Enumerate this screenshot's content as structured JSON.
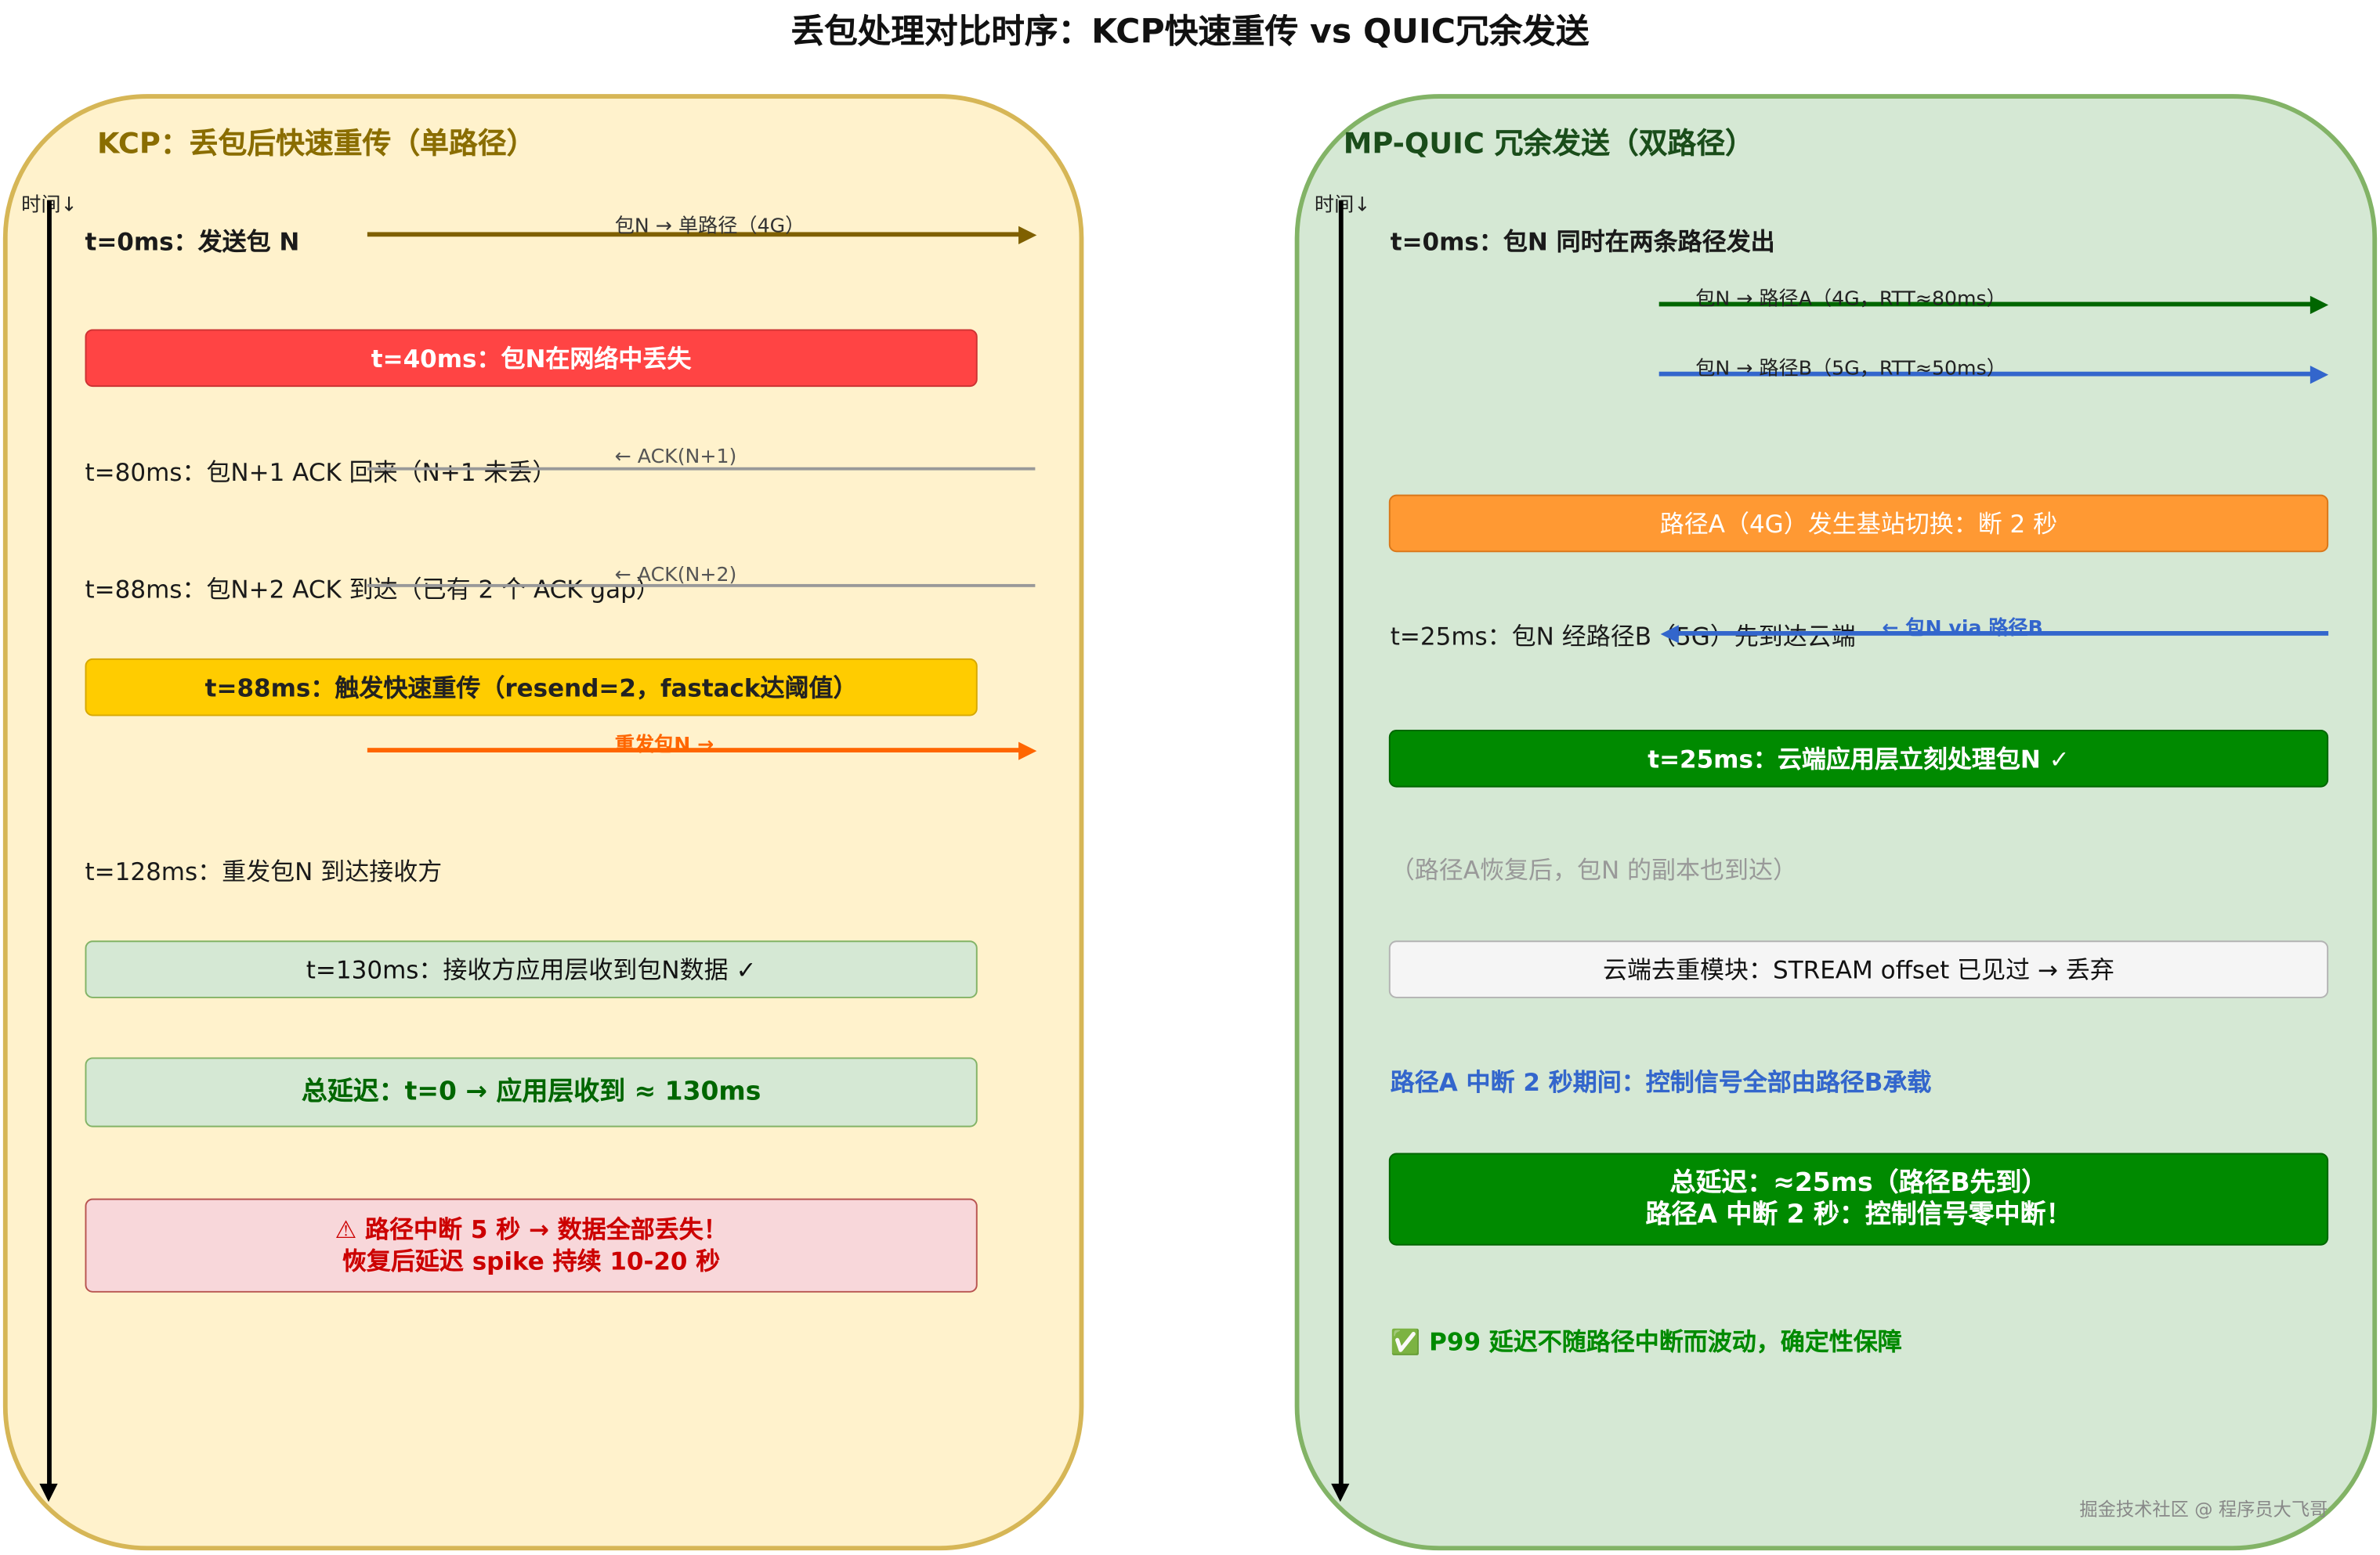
{
  "title": "丢包处理对比时序：KCP快速重传 vs QUIC冗余发送",
  "kcp": {
    "title": "KCP：丢包后快速重传（单路径）",
    "axis_label": "时间↓",
    "t0": "t=0ms：发送包 N",
    "t0_arrow": "包N → 单路径（4G）",
    "t40": "t=40ms：包N在网络中丢失",
    "t80": "t=80ms：包N+1 ACK 回来（N+1 未丢）",
    "ack1": "← ACK(N+1)",
    "t88": "t=88ms：包N+2 ACK 到达（已有 2 个 ACK gap）",
    "ack2": "← ACK(N+2)",
    "fast_resend": "t=88ms：触发快速重传（resend=2，fastack达阈值）",
    "resend_arrow": "重发包N →",
    "t128": "t=128ms：重发包N 到达接收方",
    "t130": "t=130ms：接收方应用层收到包N数据 ✓",
    "total": "总延迟：t=0 → 应用层收到 ≈ 130ms",
    "warning_line1": "⚠ 路径中断 5 秒 → 数据全部丢失！",
    "warning_line2": "恢复后延迟 spike 持续 10-20 秒"
  },
  "quic": {
    "title": "MP-QUIC 冗余发送（双路径）",
    "axis_label": "时间↓",
    "t0": "t=0ms：包N 同时在两条路径发出",
    "arrow_a": "包N → 路径A（4G，RTT≈80ms）",
    "arrow_b": "包N → 路径B（5G，RTT≈50ms）",
    "handover": "路径A（4G）发生基站切换：断 2 秒",
    "t25": "t=25ms：包N 经路径B（5G）先到达云端",
    "via_b": "← 包N via 路径B",
    "process": "t=25ms：云端应用层立刻处理包N ✓",
    "copy": "（路径A恢复后，包N 的副本也到达）",
    "dedup": "云端去重模块：STREAM offset 已见过 → 丢弃",
    "control": "路径A 中断 2 秒期间：控制信号全部由路径B承载",
    "total_line1": "总延迟：≈25ms（路径B先到）",
    "total_line2": "路径A 中断 2 秒：控制信号零中断！",
    "p99": "P99 延迟不随路径中断而波动，确定性保障",
    "p99_icon": "✅"
  },
  "watermark": "掘金技术社区 @ 程序员大飞哥",
  "colors": {
    "kcp_panel": "#fff2cc",
    "quic_panel": "#d5e8d4",
    "loss_red": "#ff4444",
    "fast_resend_yellow": "#ffcc00",
    "resend_orange": "#ff6600",
    "handover_orange": "#ff9933",
    "quic_green": "#008a00",
    "path_b_blue": "#3366cc"
  }
}
